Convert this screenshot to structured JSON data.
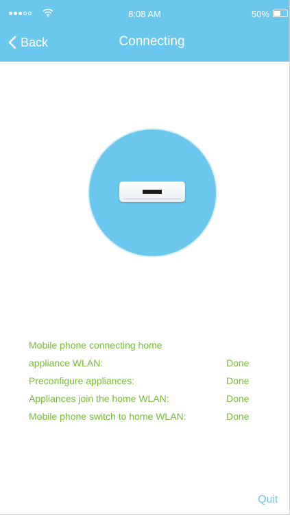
{
  "status_bar": {
    "signal": {
      "full": 3,
      "empty": 2
    },
    "time": "8:08 AM",
    "battery_percent": "50%",
    "battery_level": 0.5
  },
  "nav": {
    "back_label": "Back",
    "title": "Connecting"
  },
  "appliance": {
    "icon": "air-conditioner-icon"
  },
  "steps": [
    {
      "label": "Mobile phone connecting home appliance WLAN:",
      "status": "Done"
    },
    {
      "label": "Preconfigure appliances:",
      "status": "Done"
    },
    {
      "label": "Appliances join the home WLAN:",
      "status": "Done"
    },
    {
      "label": "Mobile phone switch to home WLAN:",
      "status": "Done"
    }
  ],
  "quit_label": "Quit",
  "colors": {
    "header": "#6cc7ee",
    "accent": "#6cc7ee",
    "success": "#76bd33",
    "background": "#ffffff"
  }
}
